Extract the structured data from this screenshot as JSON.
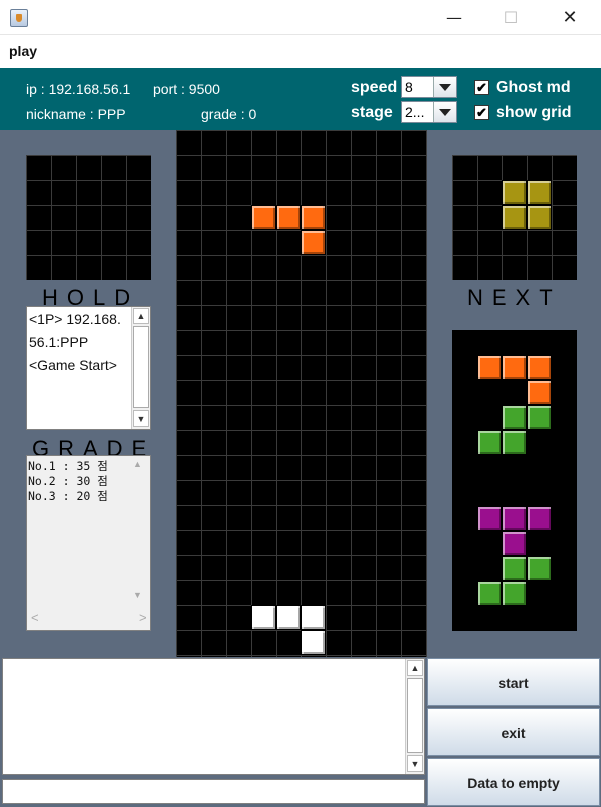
{
  "window": {
    "minimize_glyph": "—",
    "maximize_glyph": "☐",
    "close_glyph": "✕",
    "icon": "java-icon"
  },
  "menu": {
    "play": "play"
  },
  "info": {
    "ip": "ip : 192.168.56.1",
    "port": "port : 9500",
    "nickname": "nickname : PPP",
    "grade": "grade : 0",
    "speed_label": "speed",
    "speed_value": "8",
    "stage_label": "stage",
    "stage_value": "2...",
    "ghost_label": "Ghost md",
    "grid_label": "show grid",
    "check_mark": "✔"
  },
  "hold": {
    "label": "HOLD"
  },
  "next": {
    "label": "NEXT"
  },
  "log": {
    "lines": [
      "<1P> 192.168.",
      "56.1:PPP",
      "<Game Start>"
    ]
  },
  "grade_panel": {
    "label": "GRADE",
    "entries": [
      "No.1 : 35 점",
      "No.2 : 30 점",
      "No.3 : 20 점"
    ]
  },
  "scroll": {
    "up": "▲",
    "down": "▼",
    "left": "<",
    "right": ">"
  },
  "buttons": {
    "start": "start",
    "exit": "exit",
    "clear": "Data to empty"
  },
  "colors": {
    "orange": "#ff6a10",
    "white": "#ffffff",
    "yellow": "#a79512",
    "green": "#44a52c",
    "purple": "#9a0f8e",
    "info_bar": "#00656f",
    "background": "#5d6b7e"
  }
}
